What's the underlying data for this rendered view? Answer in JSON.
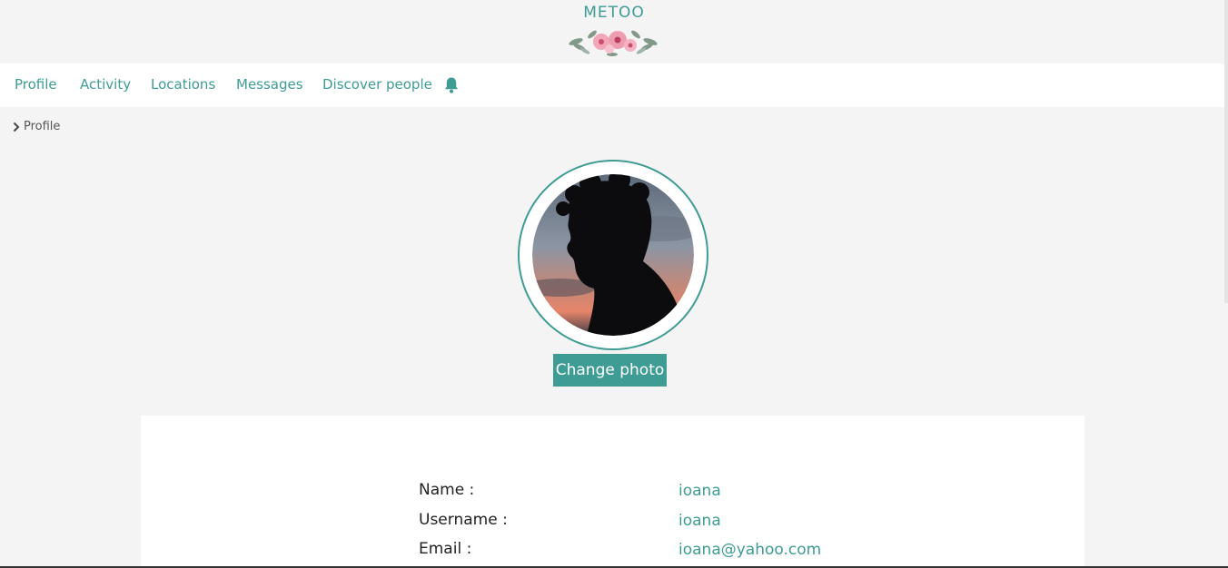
{
  "brand": {
    "title": "METOO",
    "logo_icon": "flower-garland-icon"
  },
  "nav": {
    "items": [
      {
        "label": "Profile"
      },
      {
        "label": "Activity"
      },
      {
        "label": "Locations"
      },
      {
        "label": "Messages"
      },
      {
        "label": "Discover people"
      }
    ],
    "notifications_icon": "bell-icon"
  },
  "breadcrumb": {
    "icon": "chevron-right-icon",
    "label": "Profile"
  },
  "profile": {
    "avatar_icon": "profile-photo-silhouette",
    "change_photo_label": "Change photo",
    "fields": [
      {
        "label": "Name :",
        "value": "ioana"
      },
      {
        "label": "Username :",
        "value": "ioana"
      },
      {
        "label": "Email :",
        "value": "ioana@yahoo.com"
      }
    ]
  },
  "colors": {
    "accent": "#3e9c94",
    "background": "#f4f4f4",
    "surface": "#ffffff"
  }
}
